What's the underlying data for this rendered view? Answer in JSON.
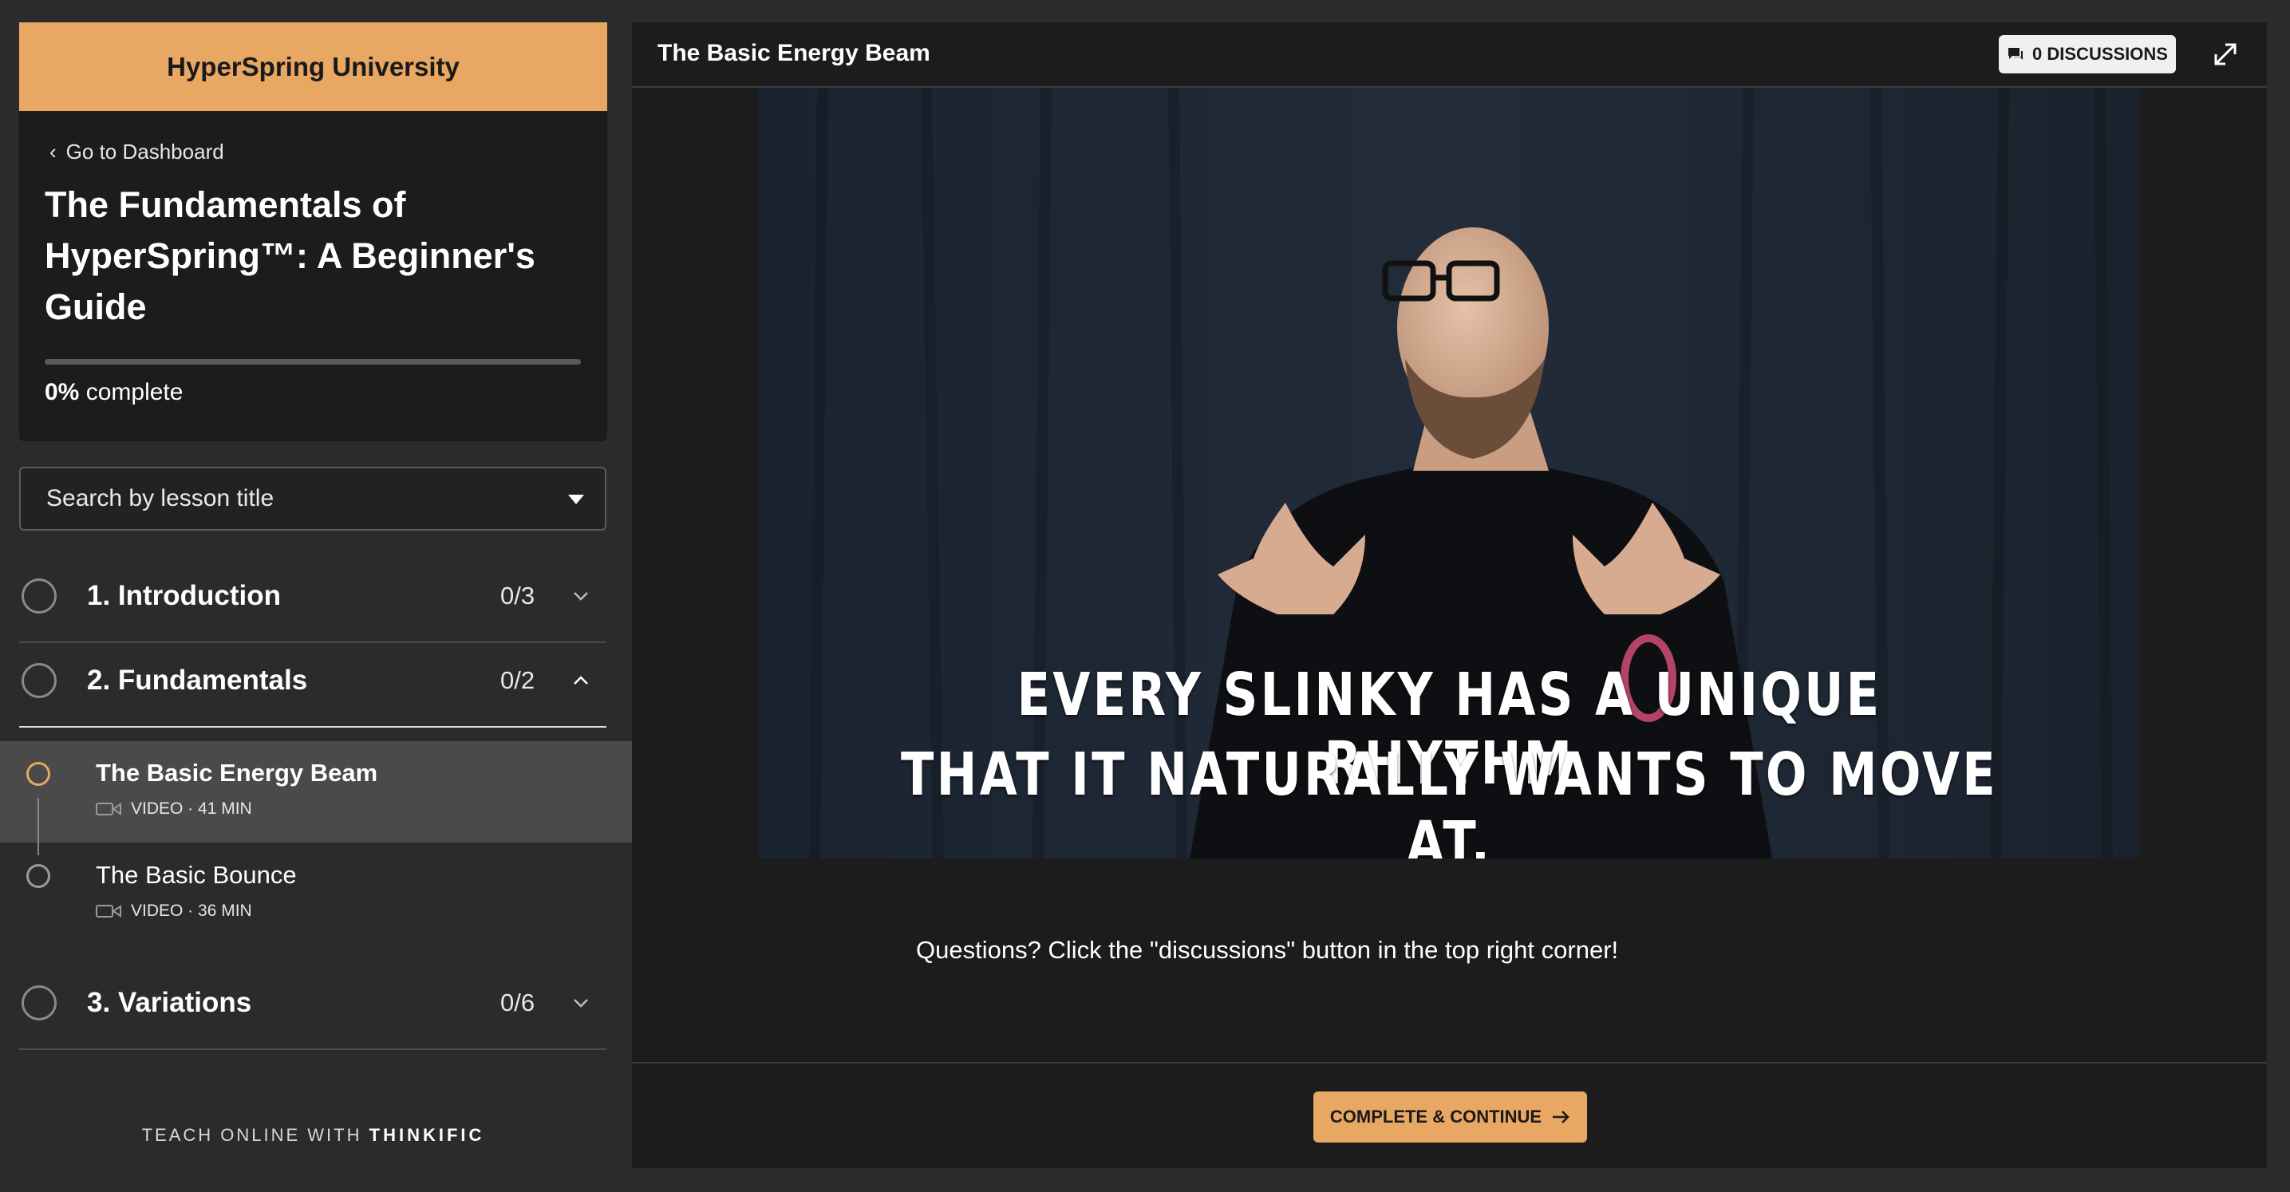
{
  "school": {
    "name": "HyperSpring University"
  },
  "course": {
    "back_label": "Go to Dashboard",
    "title": "The Fundamentals of HyperSpring™: A Beginner's Guide",
    "progress_percent": 0,
    "progress_value": "0%",
    "progress_suffix": "complete"
  },
  "search": {
    "placeholder": "Search by lesson title"
  },
  "chapters": [
    {
      "title": "1. Introduction",
      "count": "0/3",
      "expanded": false
    },
    {
      "title": "2. Fundamentals",
      "count": "0/2",
      "expanded": true,
      "lessons": [
        {
          "title": "The Basic Energy Beam",
          "meta": "VIDEO · 41 MIN",
          "active": true
        },
        {
          "title": "The Basic Bounce",
          "meta": "VIDEO · 36 MIN",
          "active": false
        }
      ]
    },
    {
      "title": "3. Variations",
      "count": "0/6",
      "expanded": false
    }
  ],
  "footer": {
    "prefix": "TEACH ONLINE WITH",
    "brand": "THINKIFIC"
  },
  "header": {
    "lesson_title": "The Basic Energy Beam",
    "discussions_label": "0 DISCUSSIONS"
  },
  "video": {
    "caption_line1": "EVERY SLINKY HAS A UNIQUE RHYTHM",
    "caption_line2": "THAT IT NATURALLY WANTS TO MOVE AT."
  },
  "lesson_note": "Questions? Click the \"discussions\" button in the top right corner!",
  "actions": {
    "complete_label": "COMPLETE & CONTINUE"
  },
  "colors": {
    "accent": "#e8a763",
    "panel": "#1c1c1c",
    "background": "#2b2b2b"
  },
  "icons": [
    "chevron-left-icon",
    "caret-down-icon",
    "chevron-down-icon",
    "chevron-up-icon",
    "video-camera-icon",
    "chat-icon",
    "expand-icon",
    "arrow-right-icon"
  ]
}
